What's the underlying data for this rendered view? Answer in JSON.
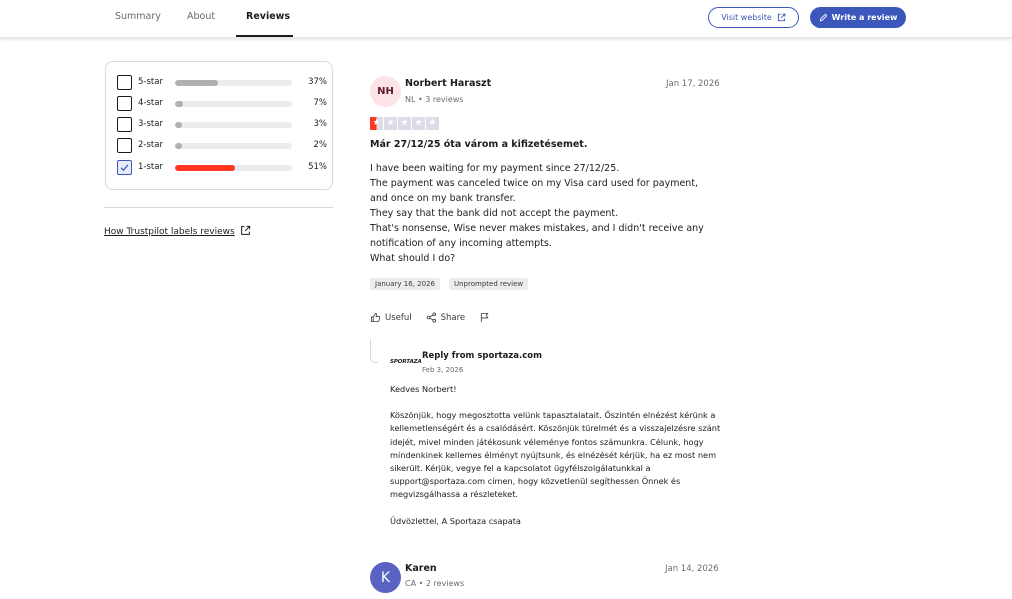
{
  "nav": {
    "tabs": [
      "Summary",
      "About",
      "Reviews"
    ],
    "active_tab": "Reviews",
    "visit_website": "Visit website",
    "write_review": "Write a review",
    "accent_color": "#3c57bc"
  },
  "filters": {
    "items": [
      {
        "label": "5-star",
        "percent": "37%",
        "fill": 0.37,
        "checked": false
      },
      {
        "label": "4-star",
        "percent": "7%",
        "fill": 0.07,
        "checked": false
      },
      {
        "label": "3-star",
        "percent": "3%",
        "fill": 0.03,
        "checked": false
      },
      {
        "label": "2-star",
        "percent": "2%",
        "fill": 0.02,
        "checked": false
      },
      {
        "label": "1-star",
        "percent": "51%",
        "fill": 0.51,
        "checked": true
      }
    ],
    "labels_link": "How Trustpilot labels reviews"
  },
  "reviews": [
    {
      "initials": "NH",
      "name": "Norbert Haraszt",
      "country": "NL",
      "review_count": "3 reviews",
      "date": "Jan 17, 2026",
      "rating": 1,
      "title": "Már 27/12/25 óta várom a kifizetésemet.",
      "body": [
        "I have been waiting for my payment since 27/12/25.",
        "The payment was canceled twice on my Visa card used for payment,",
        "and once on my bank transfer.",
        "They say that the bank did not accept the payment.",
        "That's nonsense, Wise never makes mistakes, and I didn't receive any",
        "notification of any incoming attempts.",
        "What should I do?"
      ],
      "experience_date": "January 16, 2026",
      "label": "Unprompted review",
      "actions": {
        "useful": "Useful",
        "share": "Share"
      },
      "reply": {
        "logo_text": "SPORTAZA",
        "from": "Reply from sportaza.com",
        "date": "Feb 3, 2026",
        "greeting": "Kedves Norbert!",
        "paragraph": "Köszönjük, hogy megosztotta velünk tapasztalatait. Őszintén elnézést kérünk a kellemetlenségért és a csalódásért. Köszönjük türelmét és a visszajelzésre szánt idejét, mivel minden játékosunk véleménye fontos számunkra. Célunk, hogy mindenkinek kellemes élményt nyújtsunk, és elnézését kérjük, ha ez most nem sikerült. Kérjük, vegye fel a kapcsolatot ügyfélszolgálatunkkal a support@sportaza.com címen, hogy közvetlenül segíthessen Önnek és megvizsgálhassa a részleteket.",
        "signoff": "Üdvözlettel, A Sportaza csapata"
      }
    },
    {
      "initials": "K",
      "name": "Karen",
      "country": "CA",
      "review_count": "2 reviews",
      "date": "Jan 14, 2026"
    }
  ]
}
